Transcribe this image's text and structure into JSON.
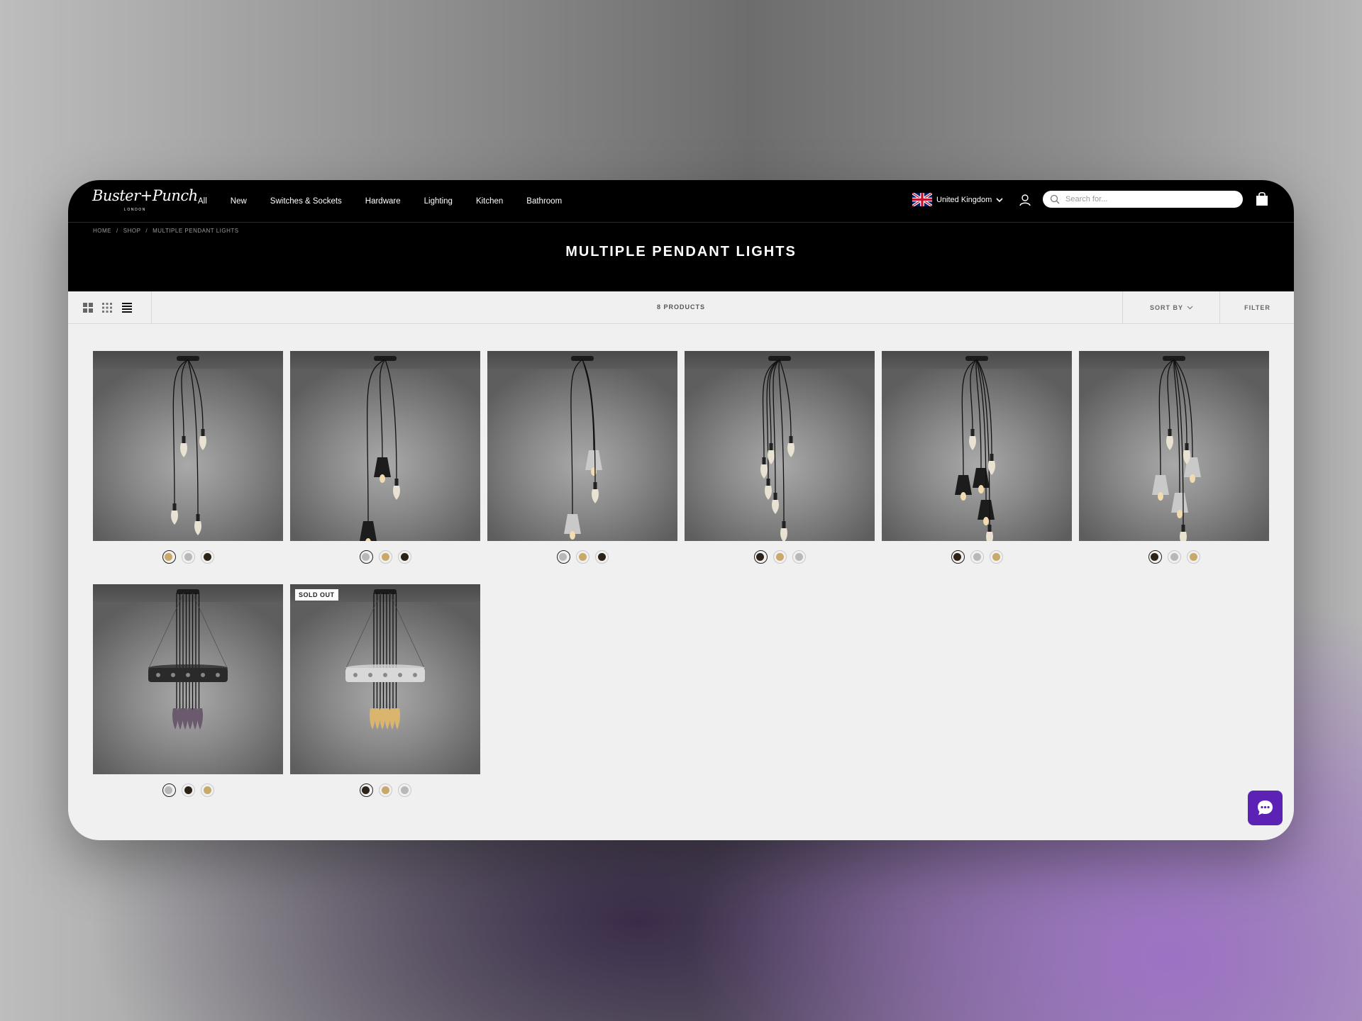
{
  "brand": {
    "logo": "Buster+Punch",
    "logo_sub": "LONDON"
  },
  "nav": [
    "All",
    "New",
    "Switches & Sockets",
    "Hardware",
    "Lighting",
    "Kitchen",
    "Bathroom"
  ],
  "region": {
    "label": "United Kingdom",
    "flag_icon": "uk-flag-icon"
  },
  "search": {
    "placeholder": "Search for..."
  },
  "breadcrumb": [
    "HOME",
    "SHOP",
    "MULTIPLE PENDANT LIGHTS"
  ],
  "page_title": "MULTIPLE PENDANT LIGHTS",
  "toolbar": {
    "count": "8 PRODUCTS",
    "sort": "SORT BY",
    "filter": "FILTER"
  },
  "colors": {
    "brass": "#c9a96a",
    "steel": "#b8b8b8",
    "graphite": "#2d2218",
    "chat": "#5b22b5"
  },
  "products": [
    {
      "swatches": [
        "brass",
        "steel",
        "graphite"
      ],
      "selected": 0,
      "badge": ""
    },
    {
      "swatches": [
        "steel",
        "brass",
        "graphite"
      ],
      "selected": 0,
      "badge": ""
    },
    {
      "swatches": [
        "steel",
        "brass",
        "graphite"
      ],
      "selected": 0,
      "badge": ""
    },
    {
      "swatches": [
        "graphite",
        "brass",
        "steel"
      ],
      "selected": 0,
      "badge": ""
    },
    {
      "swatches": [
        "graphite",
        "steel",
        "brass"
      ],
      "selected": 0,
      "badge": ""
    },
    {
      "swatches": [
        "graphite",
        "steel",
        "brass"
      ],
      "selected": 0,
      "badge": ""
    },
    {
      "swatches": [
        "steel",
        "graphite",
        "brass"
      ],
      "selected": 0,
      "badge": ""
    },
    {
      "swatches": [
        "graphite",
        "brass",
        "steel"
      ],
      "selected": 0,
      "badge": "SOLD OUT"
    }
  ]
}
